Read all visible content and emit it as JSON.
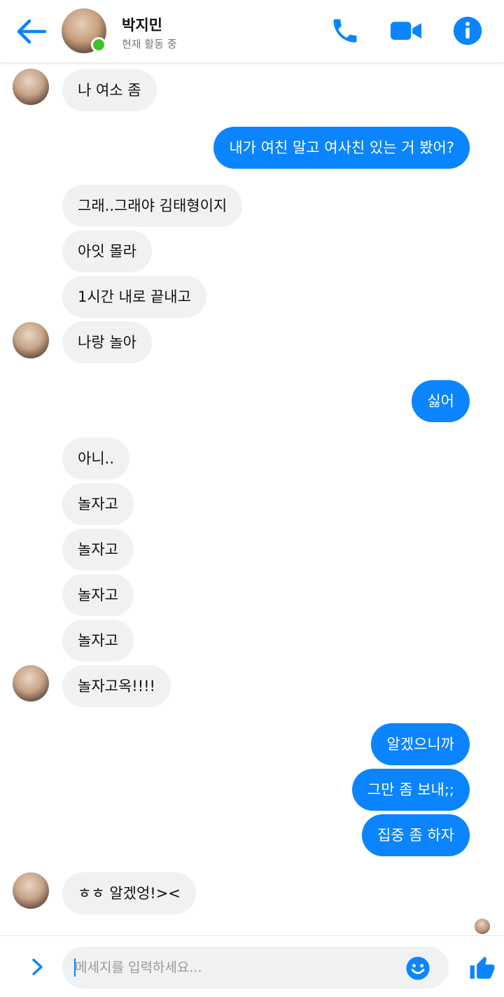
{
  "header": {
    "contact_name": "박지민",
    "status": "현재 활동 중",
    "icons": [
      "back-arrow-icon",
      "phone-icon",
      "video-camera-icon",
      "info-icon"
    ],
    "accent_color": "#0a84ff",
    "online_color": "#42c12a"
  },
  "messages": [
    {
      "sender": "them",
      "text": "나 여소 좀",
      "avatar": true
    },
    {
      "sender": "me",
      "text": "내가 여친 말고 여사친 있는 거 봤어?"
    },
    {
      "sender": "them",
      "text": "그래..그래야 김태형이지"
    },
    {
      "sender": "them",
      "text": "아잇 몰라"
    },
    {
      "sender": "them",
      "text": "1시간 내로 끝내고"
    },
    {
      "sender": "them",
      "text": "나랑 놀아",
      "avatar": true
    },
    {
      "sender": "me",
      "text": "싫어"
    },
    {
      "sender": "them",
      "text": "아니.."
    },
    {
      "sender": "them",
      "text": "놀자고"
    },
    {
      "sender": "them",
      "text": "놀자고"
    },
    {
      "sender": "them",
      "text": "놀자고"
    },
    {
      "sender": "them",
      "text": "놀자고"
    },
    {
      "sender": "them",
      "text": "놀자고옥!!!!",
      "avatar": true
    },
    {
      "sender": "me",
      "text": "알겠으니까"
    },
    {
      "sender": "me",
      "text": "그만 좀 보내;;"
    },
    {
      "sender": "me",
      "text": "집중 좀 하자"
    },
    {
      "sender": "them",
      "text": "ㅎㅎ 알겠엉!><",
      "avatar": true
    }
  ],
  "composer": {
    "placeholder": "메세지를 입력하세요...",
    "value": "",
    "icons": [
      "chevron-right-icon",
      "emoji-icon",
      "thumbs-up-icon"
    ]
  }
}
